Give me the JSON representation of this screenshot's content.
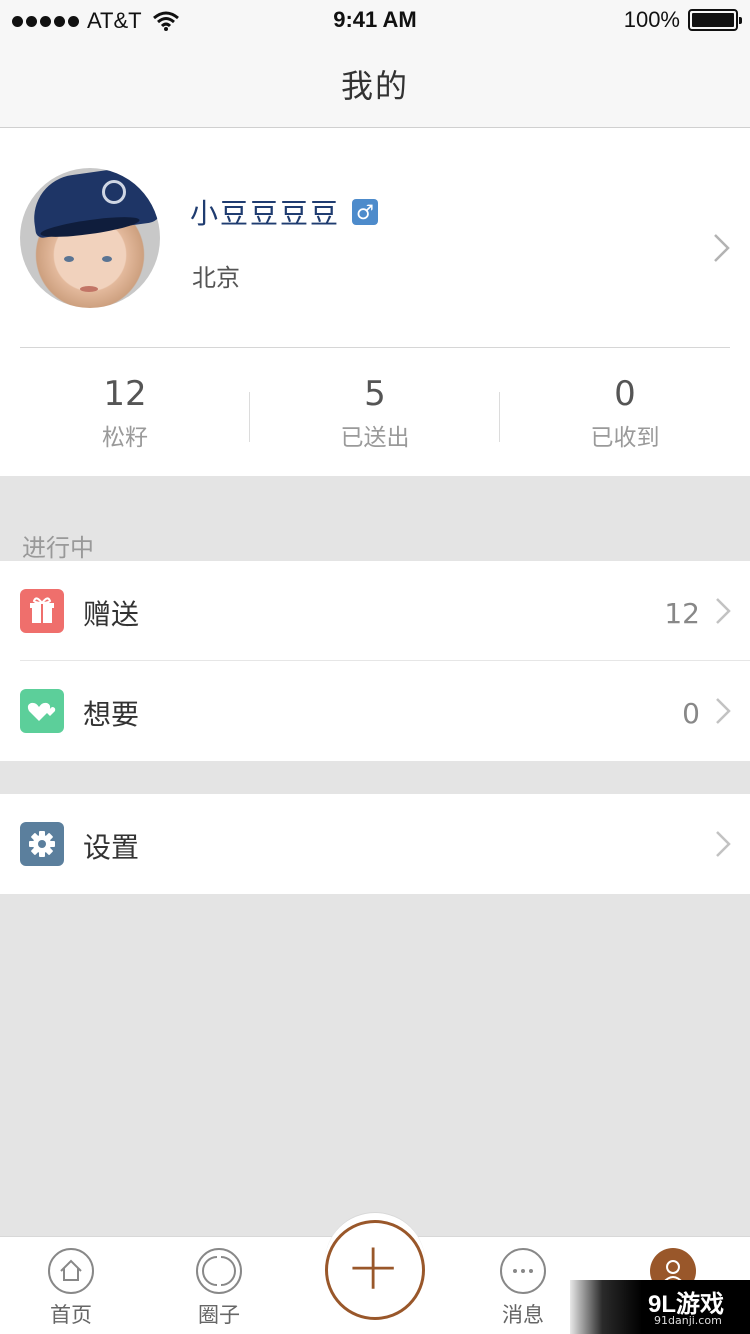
{
  "status_bar": {
    "carrier": "AT&T",
    "time": "9:41 AM",
    "battery": "100%",
    "icons": [
      "signal-dots",
      "wifi-icon",
      "battery-icon"
    ]
  },
  "nav": {
    "title": "我的"
  },
  "profile": {
    "name": "小豆豆豆豆",
    "gender_symbol": "♂",
    "city": "北京"
  },
  "stats": [
    {
      "value": "12",
      "label": "松籽"
    },
    {
      "value": "5",
      "label": "已送出"
    },
    {
      "value": "0",
      "label": "已收到"
    }
  ],
  "section": {
    "title": "进行中"
  },
  "list": [
    {
      "label": "赠送",
      "value": "12",
      "icon": "gift-icon",
      "color": "#ef6f6c"
    },
    {
      "label": "想要",
      "value": "0",
      "icon": "heart-icon",
      "color": "#5ccf9a"
    },
    {
      "label": "设置",
      "value": "",
      "icon": "gear-icon",
      "color": "#5b7f9d"
    }
  ],
  "tab_bar": {
    "tabs": [
      {
        "label": "首页",
        "icon": "home-icon"
      },
      {
        "label": "圈子",
        "icon": "circle-icon"
      },
      {
        "label": "",
        "icon": "add-icon"
      },
      {
        "label": "消息",
        "icon": "message-icon"
      },
      {
        "label": "",
        "icon": "profile-icon"
      }
    ],
    "accent_color": "#99572a"
  },
  "watermark": {
    "main": "9L游戏",
    "sub": "91danji.com"
  }
}
